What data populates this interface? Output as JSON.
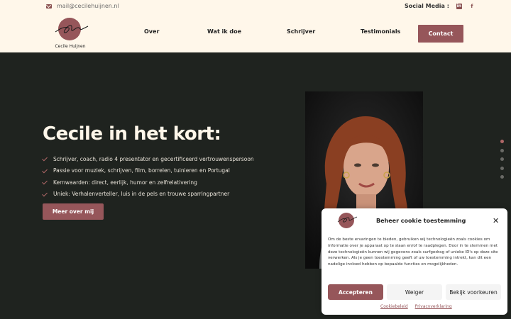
{
  "topbar": {
    "email": "mail@cecilehuijnen.nl",
    "social_label": "Social Media :",
    "social_icons": [
      "linkedin-icon",
      "facebook-icon"
    ]
  },
  "nav": {
    "logo_name": "Cecile Huijnen",
    "links": [
      "Over",
      "Wat ik doe",
      "Schrijver",
      "Testimonials"
    ],
    "contact": "Contact"
  },
  "hero": {
    "title": "Cecile in het kort:",
    "bullets": [
      "Schrijver, coach, radio 4 presentator en gecertificeerd vertrouwenspersoon",
      "Passie voor muziek, schrijven, film, borrelen, tuinieren en Portugal",
      "Kernwaarden: direct, eerlijk, humor en zelfrelativering",
      "Uniek: Verhalenverteller, luis in de pels en trouwe sparringpartner"
    ],
    "button": "Meer over mij"
  },
  "slider_dots": {
    "count": 5,
    "active_index": 0
  },
  "cookie": {
    "title": "Beheer cookie toestemming",
    "text": "Om de beste ervaringen te bieden, gebruiken wij technologieën zoals cookies om informatie over je apparaat op te slaan en/of te raadplegen. Door in te stemmen met deze technologieën kunnen wij gegevens zoals surfgedrag of unieke ID's op deze site verwerken. Als je geen toestemming geeft of uw toestemming intrekt, kan dit een nadelige invloed hebben op bepaalde functies en mogelijkheden.",
    "accept": "Accepteren",
    "deny": "Weiger",
    "prefs": "Bekijk voorkeuren",
    "link_cookie": "Cookiebeleid",
    "link_privacy": "Privacyverklaring"
  },
  "colors": {
    "accent": "#96565a",
    "cream": "#fff7ea",
    "dark_bg": "#1f231f"
  }
}
